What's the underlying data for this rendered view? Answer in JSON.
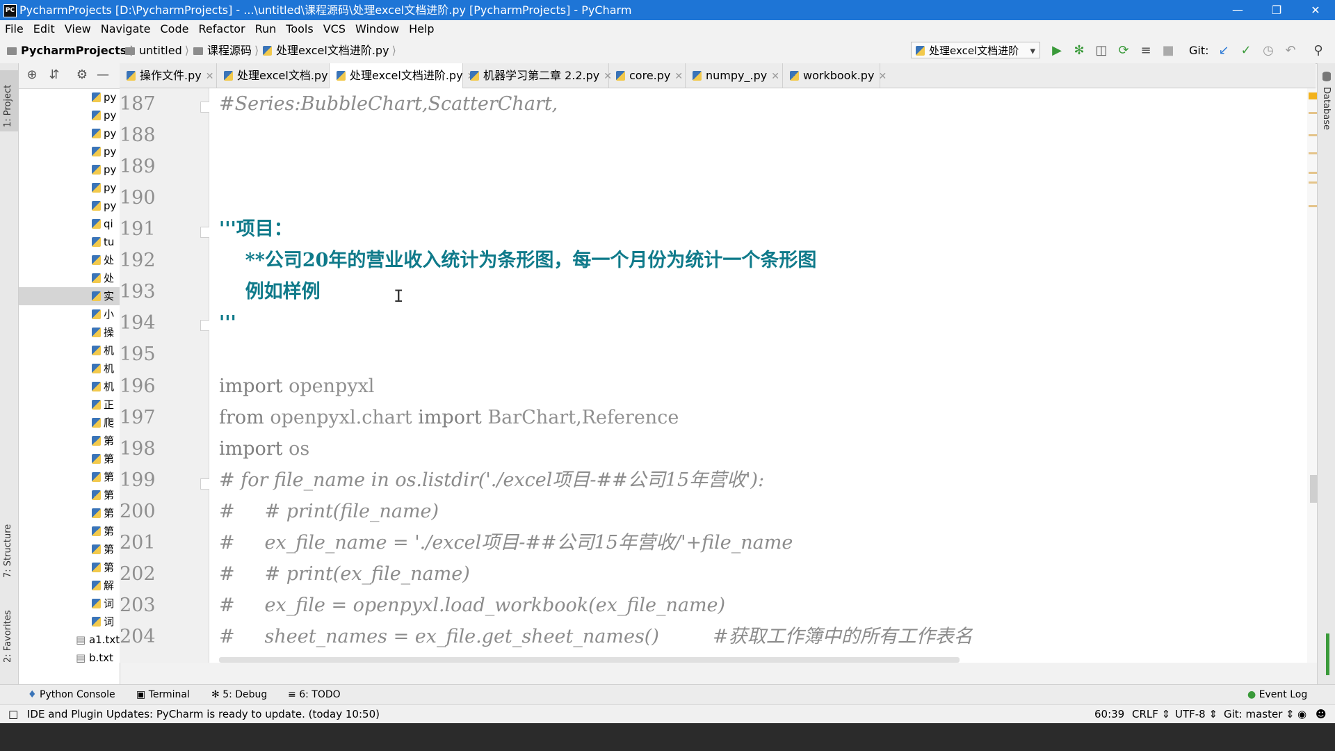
{
  "window": {
    "title": "PycharmProjects [D:\\PycharmProjects] - ...\\untitled\\课程源码\\处理excel文档进阶.py [PycharmProjects] - PyCharm",
    "app_icon": "PC"
  },
  "menu": [
    "File",
    "Edit",
    "View",
    "Navigate",
    "Code",
    "Refactor",
    "Run",
    "Tools",
    "VCS",
    "Window",
    "Help"
  ],
  "breadcrumb": [
    "PycharmProjects",
    "untitled",
    "课程源码",
    "处理excel文档进阶.py"
  ],
  "run_config": "处理excel文档进阶",
  "git_label": "Git:",
  "left_tabs": [
    "1: Project",
    "7: Structure",
    "2: Favorites"
  ],
  "right_tabs": [
    "Database"
  ],
  "project_tree": [
    "py",
    "py",
    "py",
    "py",
    "py",
    "py",
    "py",
    "qi",
    "tu",
    "处",
    "处",
    "实",
    "小",
    "操",
    "机",
    "机",
    "机",
    "正",
    "爬",
    "第",
    "第",
    "第",
    "第",
    "第",
    "第",
    "第",
    "第",
    "解",
    "词",
    "词"
  ],
  "project_tree_files": [
    "a1.txt",
    "b.txt"
  ],
  "tabs": [
    {
      "label": "操作文件.py",
      "active": false
    },
    {
      "label": "处理excel文档.py",
      "active": false
    },
    {
      "label": "处理excel文档进阶.py",
      "active": true
    },
    {
      "label": "机器学习第二章 2.2.py",
      "active": false
    },
    {
      "label": "core.py",
      "active": false
    },
    {
      "label": "numpy_.py",
      "active": false
    },
    {
      "label": "workbook.py",
      "active": false
    }
  ],
  "code_lines": [
    {
      "num": "187",
      "text": "#Series:BubbleChart,ScatterChart,"
    },
    {
      "num": "188",
      "text": ""
    },
    {
      "num": "189",
      "text": ""
    },
    {
      "num": "190",
      "text": ""
    },
    {
      "num": "191",
      "text": "'''项目："
    },
    {
      "num": "192",
      "text": "    **公司20年的营业收入统计为条形图，每一个月份为统计一个条形图"
    },
    {
      "num": "193",
      "text": "    例如样例"
    },
    {
      "num": "194",
      "text": "'''"
    },
    {
      "num": "195",
      "text": ""
    },
    {
      "num": "196",
      "kw": "import",
      "rest": " openpyxl"
    },
    {
      "num": "197",
      "kw": "from",
      "rest": " openpyxl.chart ",
      "kw2": "import",
      "rest2": " BarChart,Reference"
    },
    {
      "num": "198",
      "kw": "import",
      "rest": " os"
    },
    {
      "num": "199",
      "text": "# for file_name in os.listdir('./excel项目-##公司15年营收'):"
    },
    {
      "num": "200",
      "text": "#     # print(file_name)"
    },
    {
      "num": "201",
      "text": "#     ex_file_name = './excel项目-##公司15年营收/'+file_name"
    },
    {
      "num": "202",
      "text": "#     # print(ex_file_name)"
    },
    {
      "num": "203",
      "text": "#     ex_file = openpyxl.load_workbook(ex_file_name)"
    },
    {
      "num": "204",
      "text": "#     sheet_names = ex_file.get_sheet_names()         #获取工作簿中的所有工作表名"
    }
  ],
  "tool_windows": [
    "Python Console",
    "Terminal",
    "5: Debug",
    "6: TODO"
  ],
  "event_log": "Event Log",
  "status": {
    "message": "IDE and Plugin Updates: PyCharm is ready to update. (today 10:50)",
    "position": "60:39",
    "line_sep": "CRLF",
    "encoding": "UTF-8",
    "vcs": "Git: master"
  }
}
